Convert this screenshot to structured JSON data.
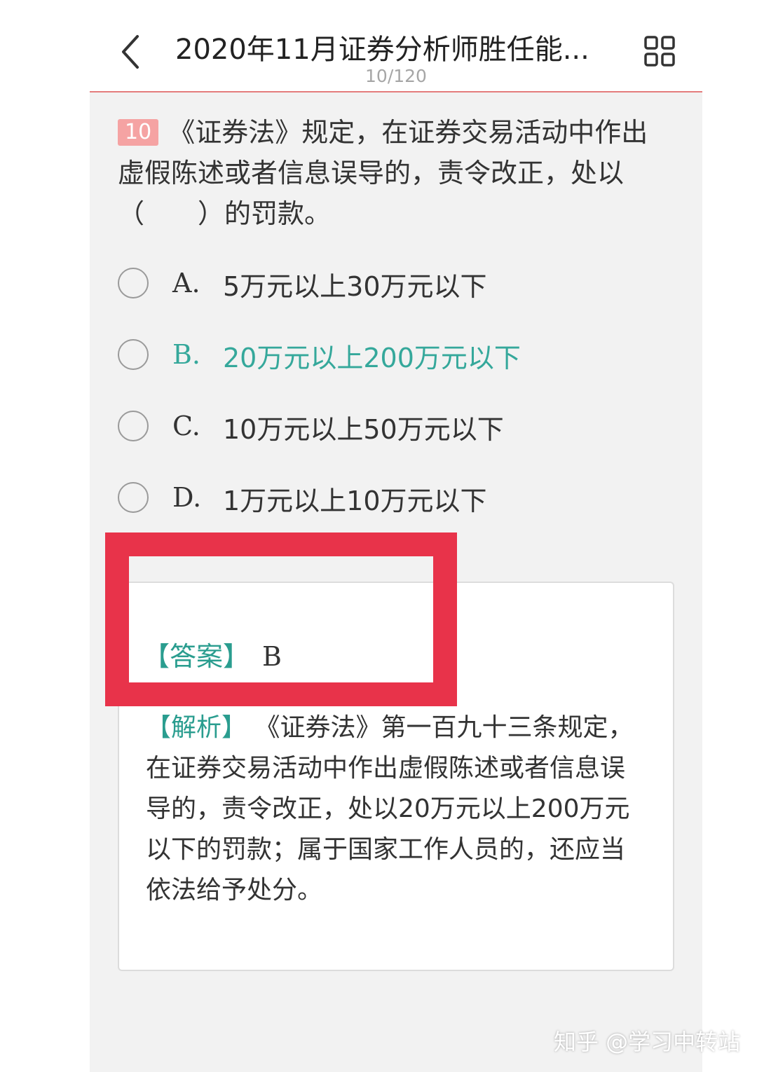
{
  "header": {
    "title": "2020年11月证券分析师胜任能...",
    "progress": "10/120",
    "back_icon": "chevron-left-icon",
    "menu_icon": "grid-icon"
  },
  "question": {
    "number": "10",
    "text": "《证券法》规定，在证券交易活动中作出虚假陈述或者信息误导的，责令改正，处以（　　）的罚款。"
  },
  "options": [
    {
      "letter": "A.",
      "text": "5万元以上30万元以下",
      "correct": false
    },
    {
      "letter": "B.",
      "text": "20万元以上200万元以下",
      "correct": true
    },
    {
      "letter": "C.",
      "text": "10万元以上50万元以下",
      "correct": false
    },
    {
      "letter": "D.",
      "text": "1万元以上10万元以下",
      "correct": false
    }
  ],
  "answer": {
    "label": "【答案】",
    "value": "B"
  },
  "analysis": {
    "label": "【解析】",
    "text": "《证券法》第一百九十三条规定，在证券交易活动中作出虚假陈述或者信息误导的，责令改正，处以20万元以上200万元以下的罚款；属于国家工作人员的，还应当依法给予处分。"
  },
  "watermark": "知乎 @学习中转站",
  "colors": {
    "correct": "#35a89b",
    "tag": "#2a9d8f",
    "highlight": "#e8334a",
    "header_rule": "#e47c7c"
  }
}
